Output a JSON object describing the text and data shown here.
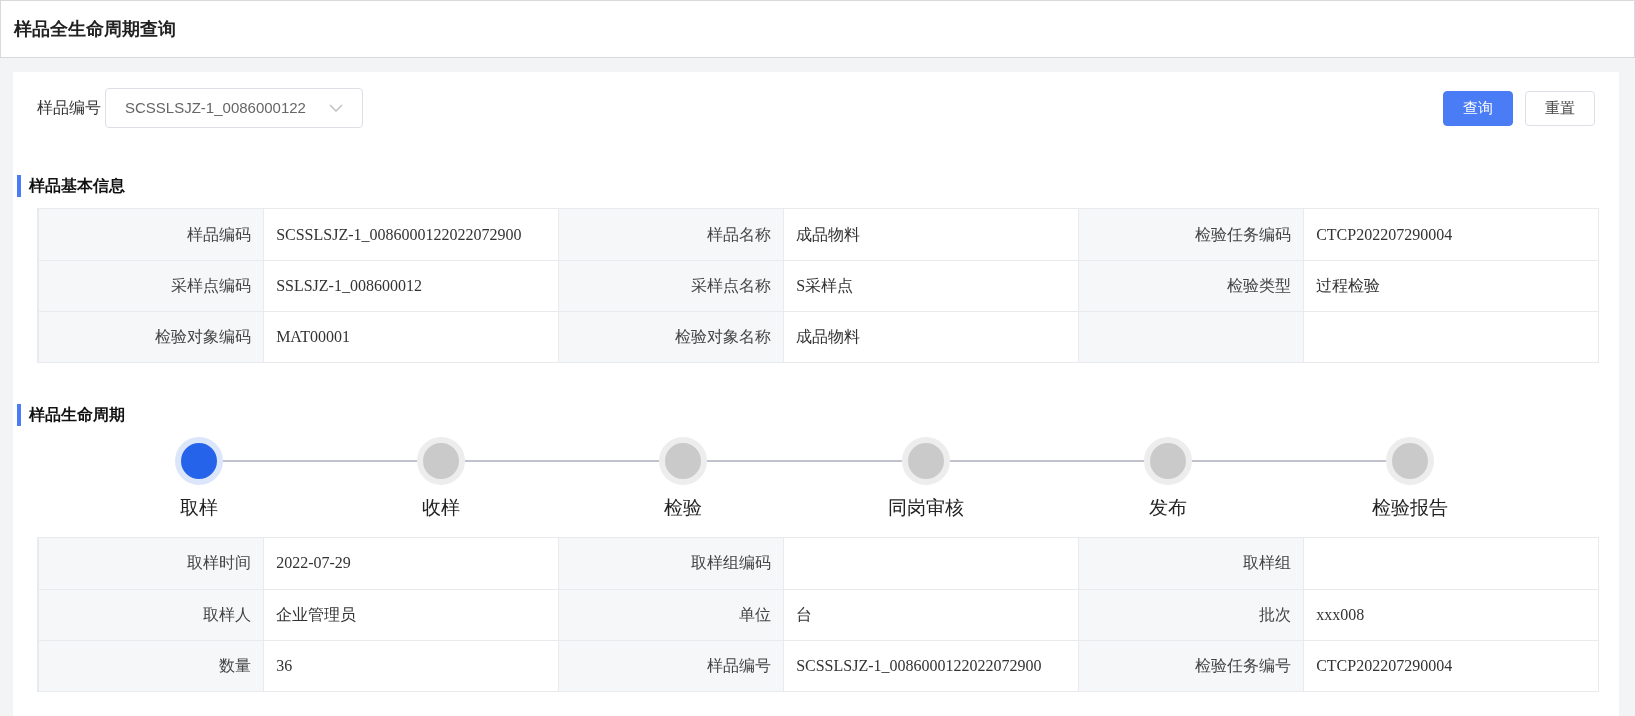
{
  "page_title": "样品全生命周期查询",
  "filter": {
    "label": "样品编号",
    "value": "SCSSLSJZ-1_0086000122"
  },
  "buttons": [
    {
      "label": "查询",
      "kind": "primary"
    },
    {
      "label": "重置",
      "kind": "default"
    }
  ],
  "basic_info": {
    "title": "样品基本信息",
    "rows": [
      [
        {
          "label": "样品编码",
          "value": "SCSSLSJZ-1_0086000122022072900"
        },
        {
          "label": "样品名称",
          "value": "成品物料"
        },
        {
          "label": "检验任务编码",
          "value": "CTCP202207290004"
        }
      ],
      [
        {
          "label": "采样点编码",
          "value": "SSLSJZ-1_008600012"
        },
        {
          "label": "采样点名称",
          "value": "S采样点"
        },
        {
          "label": "检验类型",
          "value": "过程检验"
        }
      ],
      [
        {
          "label": "检验对象编码",
          "value": "MAT00001"
        },
        {
          "label": "检验对象名称",
          "value": "成品物料"
        }
      ]
    ]
  },
  "lifecycle": {
    "title": "样品生命周期",
    "steps": [
      {
        "label": "取样",
        "selected": true
      },
      {
        "label": "收样",
        "selected": false
      },
      {
        "label": "检验",
        "selected": false
      },
      {
        "label": "同岗审核",
        "selected": false
      },
      {
        "label": "发布",
        "selected": false
      },
      {
        "label": "检验报告",
        "selected": false
      }
    ],
    "rows": [
      [
        {
          "label": "取样时间",
          "value": "2022-07-29"
        },
        {
          "label": "取样组编码"
        },
        {
          "label": "取样组"
        }
      ],
      [
        {
          "label": "取样人",
          "value": "企业管理员"
        },
        {
          "label": "单位",
          "value": "台"
        },
        {
          "label": "批次",
          "value": "xxx008"
        }
      ],
      [
        {
          "label": "数量",
          "value": "36"
        },
        {
          "label": "样品编号",
          "value": "SCSSLSJZ-1_0086000122022072900"
        },
        {
          "label": "检验任务编号",
          "value": "CTCP202207290004"
        }
      ]
    ]
  }
}
